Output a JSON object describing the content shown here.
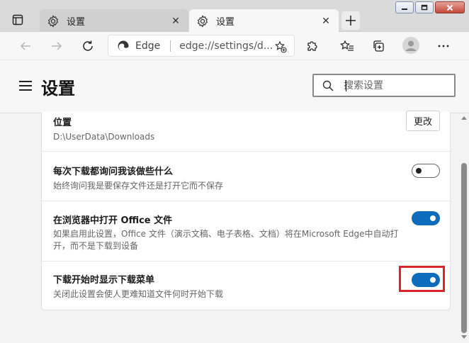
{
  "browser": {
    "tabs": [
      {
        "title": "设置",
        "active": false
      },
      {
        "title": "设置",
        "active": true
      }
    ],
    "brand": "Edge",
    "url": "edge://settings/d..."
  },
  "settings": {
    "title": "设置",
    "search_placeholder": "搜索设置"
  },
  "download": {
    "location": {
      "title": "位置",
      "path": "D:\\UserData\\Downloads",
      "change_label": "更改"
    },
    "ask_each": {
      "title": "每次下载都询问我该做些什么",
      "desc": "始终询问我是要保存文件还是打开它而不保存",
      "enabled": false
    },
    "open_office": {
      "title": "在浏览器中打开 Office 文件",
      "desc_line1": "如果启用此设置，Office 文件（演示文稿、电子表格、文档）将在Microsoft Edge中自动打",
      "desc_line2": "开，而不是下载到设备",
      "enabled": true
    },
    "show_menu": {
      "title": "下载开始时显示下载菜单",
      "desc": "关闭此设置会使人更难知道文件何时开始下载",
      "enabled": true
    }
  },
  "colors": {
    "accent": "#0f6cbd",
    "highlight": "#d9252a"
  }
}
